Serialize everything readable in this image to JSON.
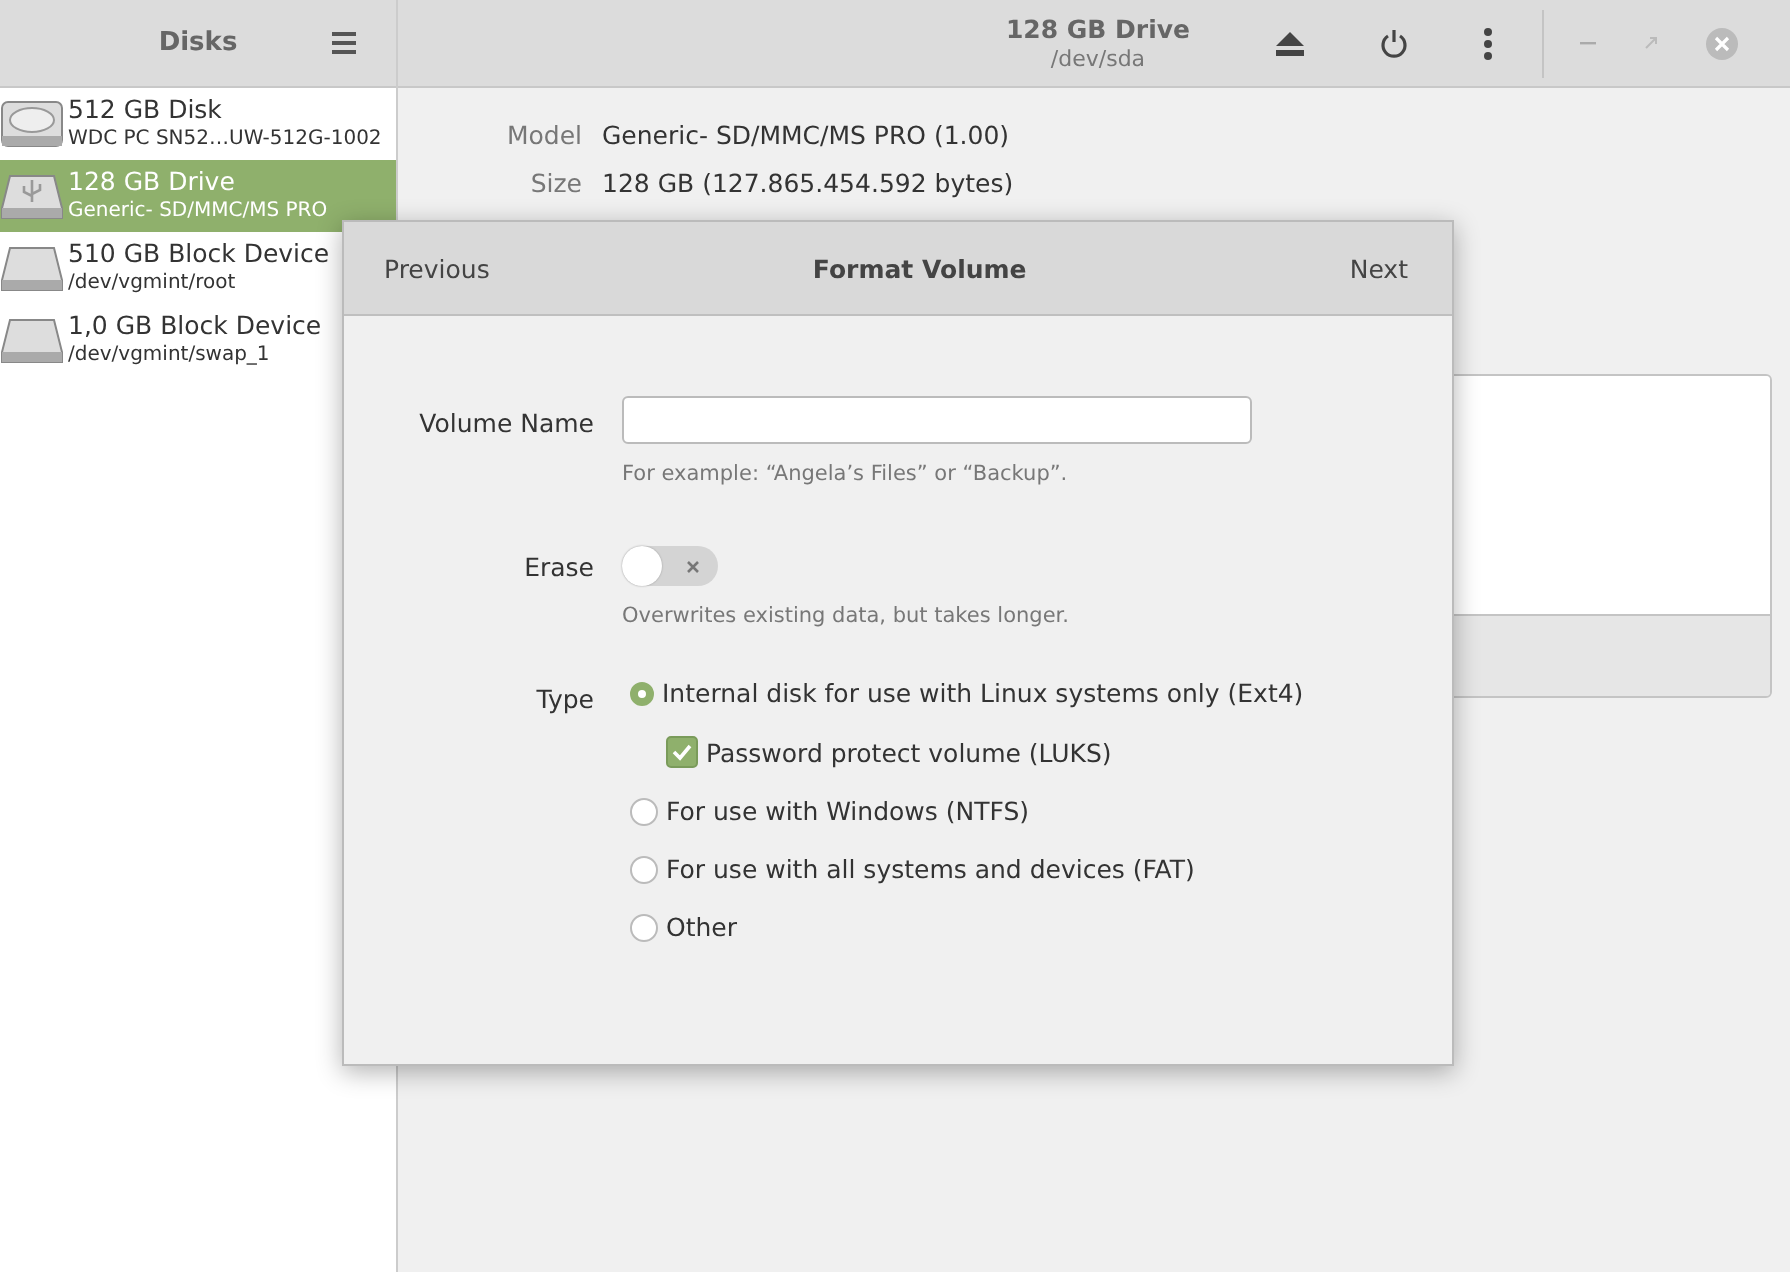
{
  "sidebar": {
    "title": "Disks",
    "items": [
      {
        "name": "512 GB Disk",
        "detail": "WDC PC SN52…UW-512G-1002",
        "kind": "hdd",
        "selected": false
      },
      {
        "name": "128 GB Drive",
        "detail": "Generic- SD/MMC/MS PRO",
        "kind": "usb",
        "selected": true
      },
      {
        "name": "510 GB Block Device",
        "detail": "/dev/vgmint/root",
        "kind": "block",
        "selected": false
      },
      {
        "name": "1,0 GB Block Device",
        "detail": "/dev/vgmint/swap_1",
        "kind": "block",
        "selected": false
      }
    ]
  },
  "header": {
    "title": "128 GB Drive",
    "subtitle": "/dev/sda"
  },
  "properties": [
    {
      "label": "Model",
      "value": "Generic- SD/MMC/MS PRO (1.00)"
    },
    {
      "label": "Size",
      "value": "128 GB (127.865.454.592 bytes)"
    }
  ],
  "dialog": {
    "title": "Format Volume",
    "previous": "Previous",
    "next": "Next",
    "volume_name": {
      "label": "Volume Name",
      "hint": "For example: “Angela’s Files” or “Backup”."
    },
    "erase": {
      "label": "Erase",
      "on": false,
      "hint": "Overwrites existing data, but takes longer."
    },
    "type": {
      "label": "Type",
      "options": [
        {
          "label": "Internal disk for use with Linux systems only (Ext4)",
          "selected": true,
          "sub": {
            "label": "Password protect volume (LUKS)",
            "checked": true
          }
        },
        {
          "label": "For use with Windows (NTFS)",
          "selected": false
        },
        {
          "label": "For use with all systems and devices (FAT)",
          "selected": false
        },
        {
          "label": "Other",
          "selected": false
        }
      ]
    }
  }
}
